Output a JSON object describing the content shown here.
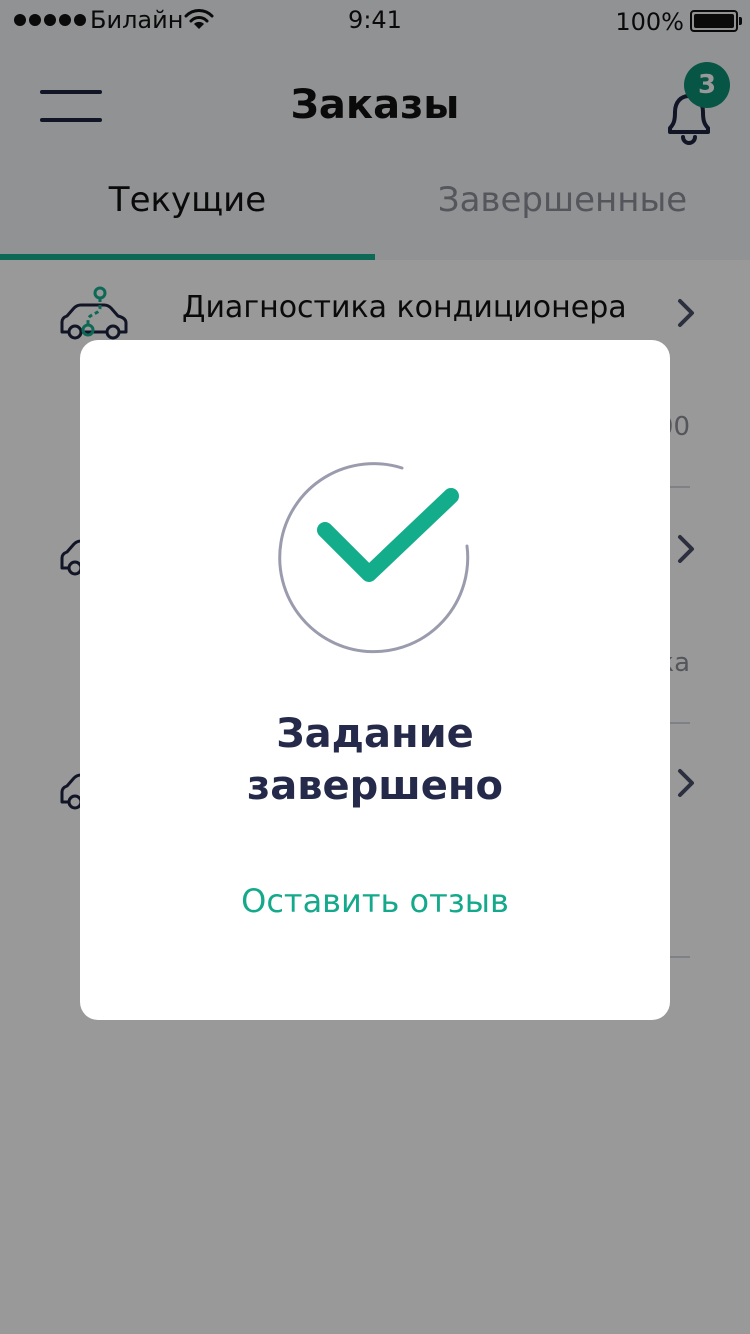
{
  "status_bar": {
    "carrier": "Билайн",
    "time": "9:41",
    "battery": "100%"
  },
  "header": {
    "title": "Заказы",
    "notification_count": "3"
  },
  "tabs": [
    {
      "label": "Текущие",
      "active": true
    },
    {
      "label": "Завершенные",
      "active": false
    }
  ],
  "orders": [
    {
      "title": "Диагностика кондиционера",
      "icon": "car-route-icon",
      "meta": "00"
    },
    {
      "title": "",
      "icon": "car-route-icon",
      "meta": "ка"
    },
    {
      "title": "",
      "icon": "car-route-icon",
      "meta": ""
    }
  ],
  "modal": {
    "title_line1": "Задание",
    "title_line2": "завершено",
    "review_link": "Оставить отзыв",
    "icon": "checkmark-circle-icon"
  },
  "colors": {
    "accent": "#17b08e",
    "badge": "#0c8e74",
    "title_dark": "#25294a",
    "link": "#14a98b"
  }
}
